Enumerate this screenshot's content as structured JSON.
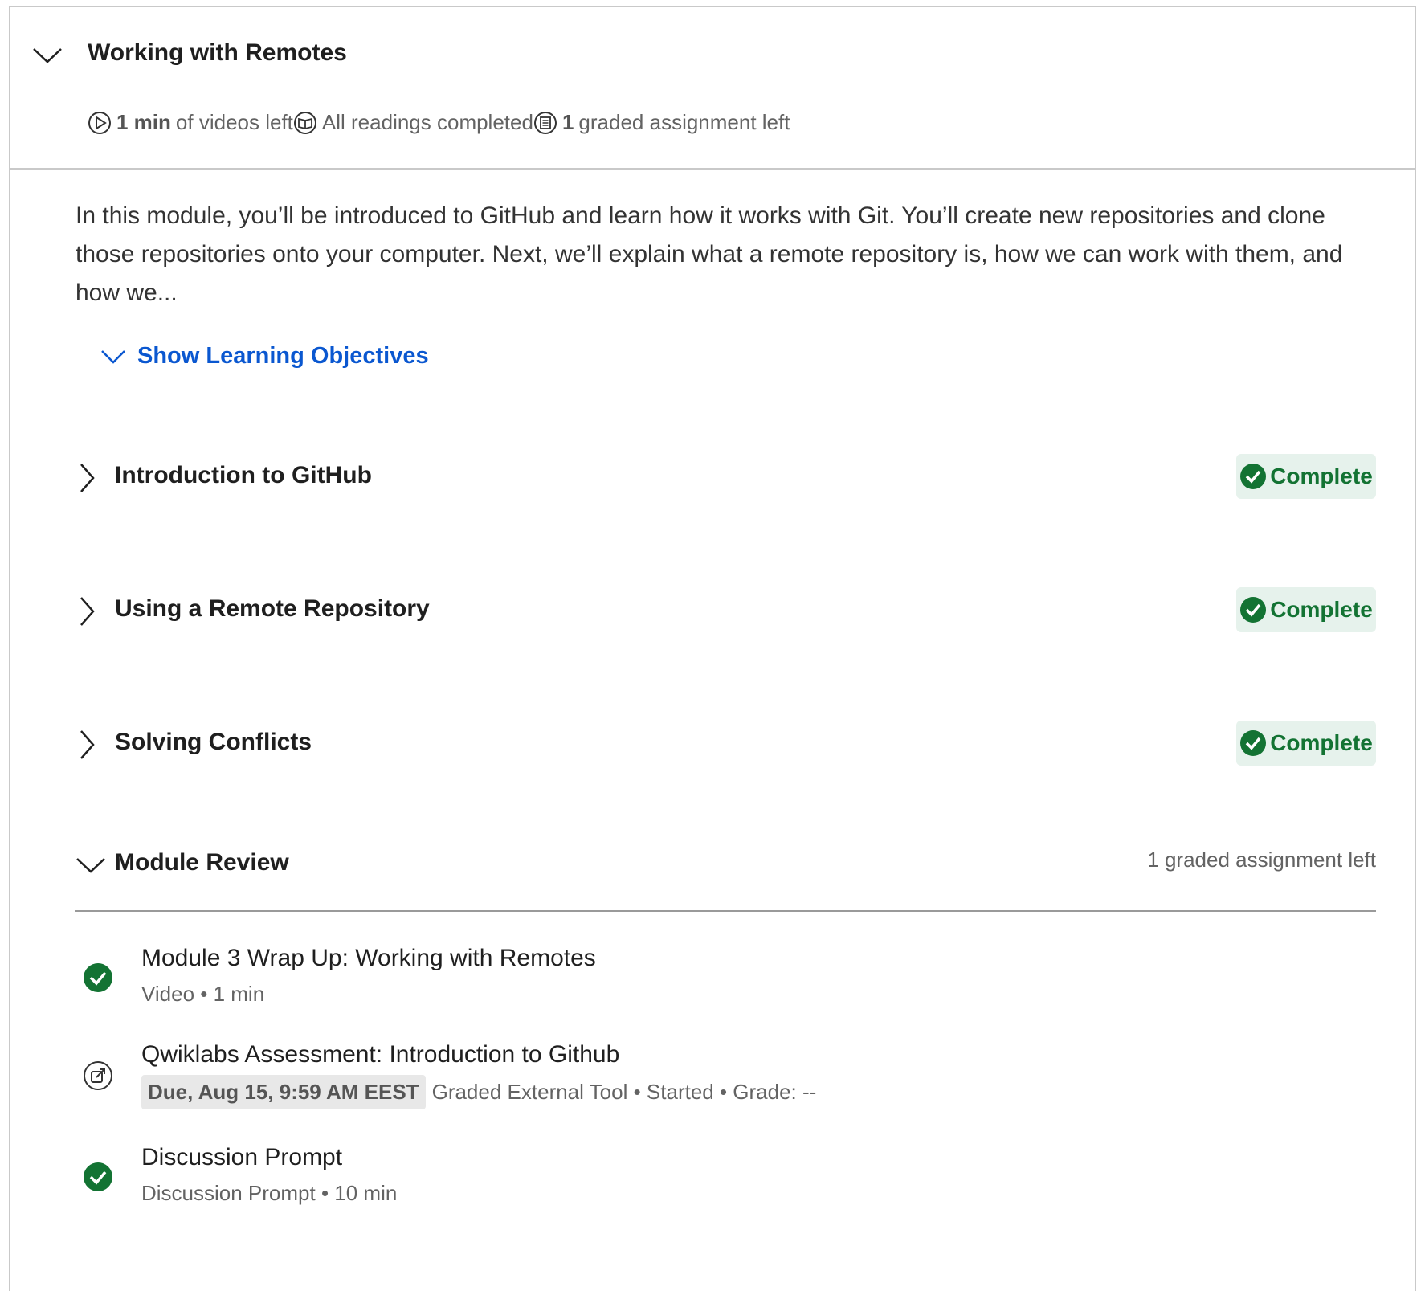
{
  "module": {
    "title": "Working with Remotes",
    "stats": {
      "videos_value": "1 min",
      "videos_label": "of videos left",
      "readings_label": "All readings completed",
      "graded_value": "1",
      "graded_label": "graded assignment left"
    },
    "description": "In this module, you’ll be introduced to GitHub and learn how it works with Git. You’ll create new repositories and clone those repositories onto your computer. Next, we’ll explain what a remote repository is, how we can work with them, and how we...",
    "objectives_label": "Show Learning Objectives"
  },
  "lessons": [
    {
      "title": "Introduction to GitHub",
      "status": "Complete"
    },
    {
      "title": "Using a Remote Repository",
      "status": "Complete"
    },
    {
      "title": "Solving Conflicts",
      "status": "Complete"
    }
  ],
  "review": {
    "title": "Module Review",
    "summary": "1 graded assignment left",
    "items": [
      {
        "name": "Module 3 Wrap Up: Working with Remotes",
        "meta": "Video • 1 min",
        "icon": "check-circle-icon"
      },
      {
        "name": "Qwiklabs Assessment: Introduction to Github",
        "due": "Due, Aug 15, 9:59 AM EEST",
        "meta": "Graded External Tool • Started • Grade: --",
        "icon": "external-link-icon"
      },
      {
        "name": "Discussion Prompt",
        "meta": "Discussion Prompt • 10 min",
        "icon": "check-circle-icon"
      }
    ]
  },
  "colors": {
    "accent": "#0a57d0",
    "success": "#137333",
    "success_bg": "#e6f2ec",
    "border": "#c9c9c9"
  }
}
